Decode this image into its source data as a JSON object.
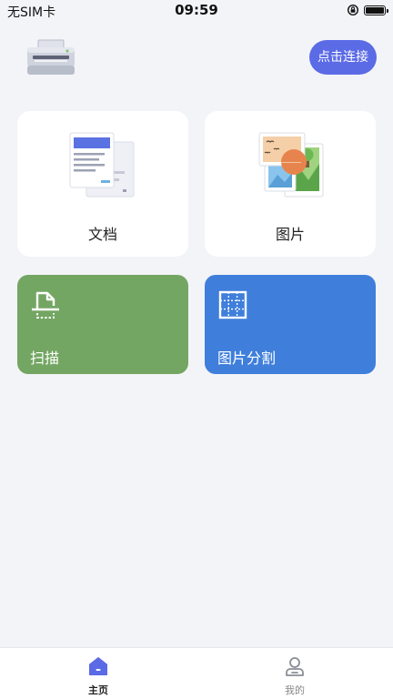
{
  "status_bar": {
    "carrier": "无SIM卡",
    "time": "09:59"
  },
  "header": {
    "icon": "printer-icon",
    "connect_label": "点击连接"
  },
  "cards": [
    {
      "label": "文档",
      "icon": "document-icon"
    },
    {
      "label": "图片",
      "icon": "picture-icon"
    }
  ],
  "tiles": [
    {
      "label": "扫描",
      "icon": "scan-icon",
      "color": "#73a662"
    },
    {
      "label": "图片分割",
      "icon": "grid-split-icon",
      "color": "#3f7fdb"
    }
  ],
  "tabbar": {
    "tabs": [
      {
        "label": "主页",
        "icon": "home-icon",
        "active": true
      },
      {
        "label": "我的",
        "icon": "user-icon",
        "active": false
      }
    ]
  },
  "colors": {
    "accent": "#5b6be6",
    "background": "#f3f4f8"
  }
}
